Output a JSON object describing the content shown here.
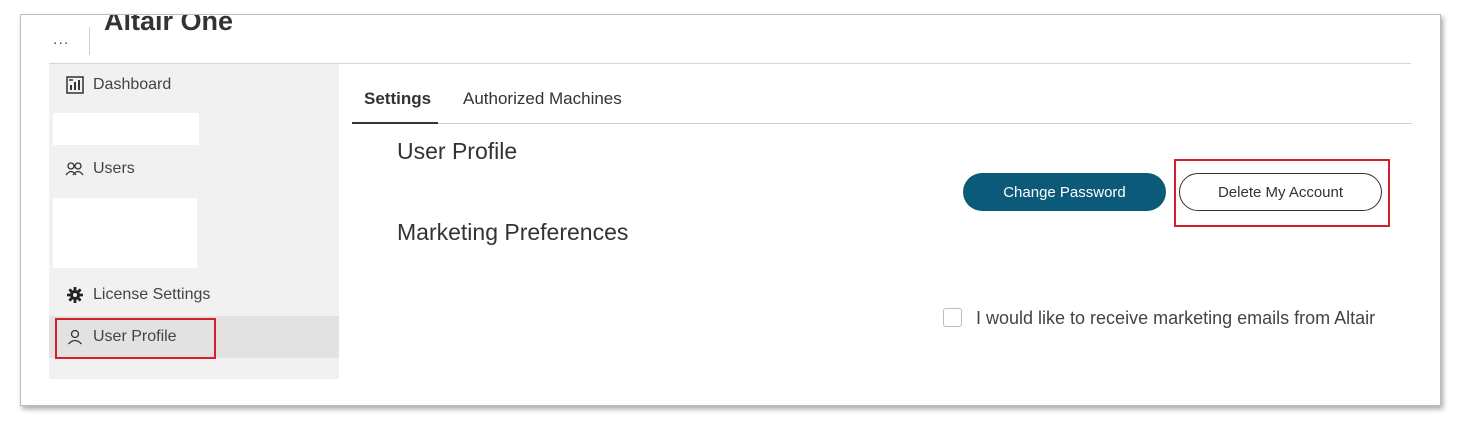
{
  "app": {
    "menu_glyph": "...",
    "title": "Altair One"
  },
  "sidebar": {
    "items": [
      {
        "label": "Dashboard",
        "icon": "dashboard-icon"
      },
      {
        "label": "Users",
        "icon": "users-icon"
      },
      {
        "label": "License Settings",
        "icon": "gear-icon"
      },
      {
        "label": "User Profile",
        "icon": "user-icon",
        "active": true
      }
    ]
  },
  "tabs": [
    {
      "label": "Settings",
      "active": true
    },
    {
      "label": "Authorized Machines",
      "active": false
    }
  ],
  "sections": {
    "user_profile": "User Profile",
    "marketing": "Marketing Preferences"
  },
  "buttons": {
    "change_password": "Change Password",
    "delete_account": "Delete My Account"
  },
  "marketing_checkbox": {
    "label": "I would like to receive marketing emails from Altair",
    "checked": false
  },
  "colors": {
    "primary": "#0c5a7a",
    "highlight": "#d21f2a",
    "sidebar_bg": "#f1f1f1"
  }
}
